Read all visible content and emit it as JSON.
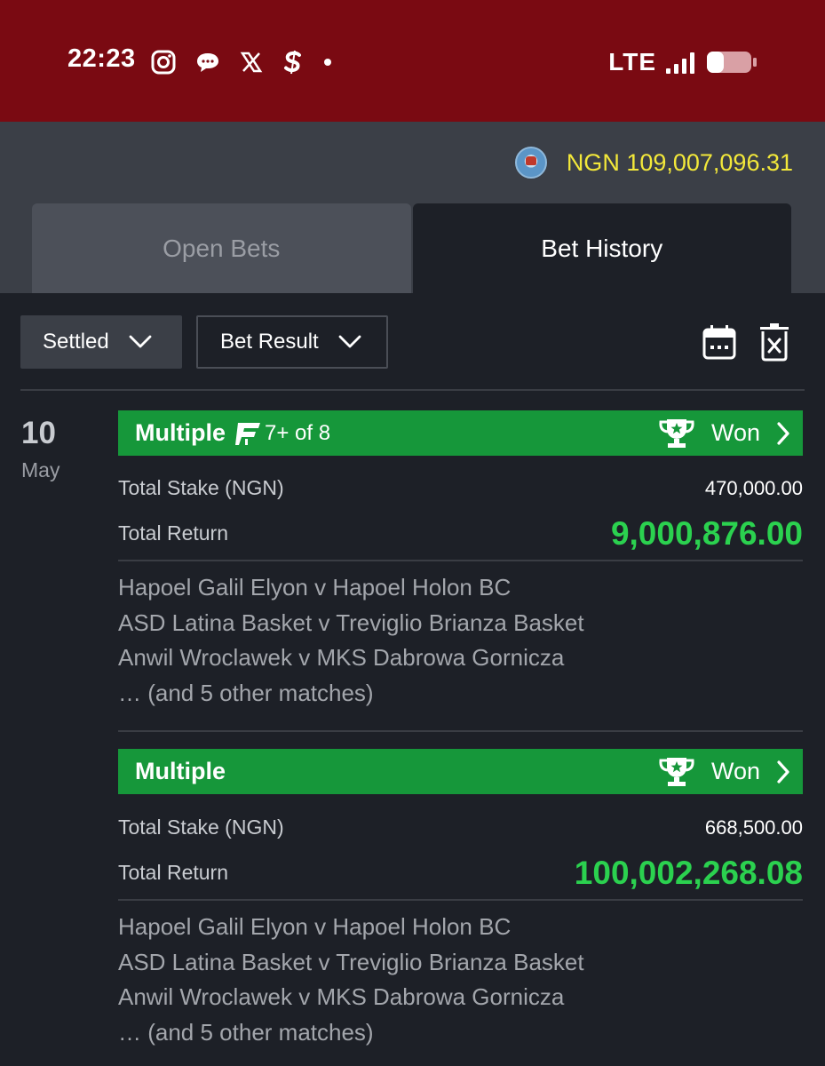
{
  "status_bar": {
    "time": "22:23",
    "icons": [
      "instagram-icon",
      "chat-icon",
      "x-icon",
      "s-app-icon",
      "dot-icon"
    ],
    "network": "LTE",
    "battery_level": 0.35
  },
  "header": {
    "balance": "NGN 109,007,096.31"
  },
  "tabs": [
    {
      "label": "Open Bets",
      "active": false
    },
    {
      "label": "Bet History",
      "active": true
    }
  ],
  "filters": {
    "status": "Settled",
    "result": "Bet Result"
  },
  "date": {
    "day": "10",
    "month": "May"
  },
  "bets": [
    {
      "type": "Multiple",
      "boost": "7+ of 8",
      "status": "Won",
      "stake_label": "Total Stake (NGN)",
      "stake": "470,000.00",
      "return_label": "Total Return",
      "return": "9,000,876.00",
      "matches": [
        "Hapoel Galil Elyon v Hapoel Holon BC",
        "ASD Latina Basket v Treviglio Brianza Basket",
        "Anwil Wroclawek v MKS Dabrowa Gornicza",
        "… (and 5 other matches)"
      ]
    },
    {
      "type": "Multiple",
      "status": "Won",
      "stake_label": "Total Stake (NGN)",
      "stake": "668,500.00",
      "return_label": "Total Return",
      "return": "100,002,268.08",
      "matches": [
        "Hapoel Galil Elyon v Hapoel Holon BC",
        "ASD Latina Basket v Treviglio Brianza Basket",
        "Anwil Wroclawek v MKS Dabrowa Gornicza",
        "… (and 5 other matches)"
      ]
    }
  ],
  "colors": {
    "status_bar": "#7a0a12",
    "header": "#3b3f47",
    "background": "#1d2027",
    "won_banner": "#16973a",
    "return_green": "#2bd14f",
    "balance_yellow": "#f3e83a"
  }
}
